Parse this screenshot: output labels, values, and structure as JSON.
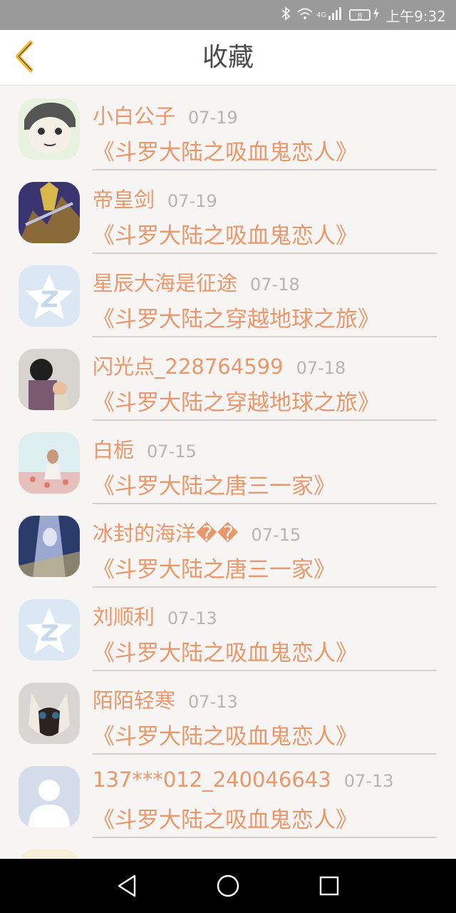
{
  "status_bar": {
    "icons": [
      "bluetooth-icon",
      "wifi-icon",
      "4g-icon",
      "signal-icon"
    ],
    "network": "4G",
    "battery": "8",
    "time": "上午9:32"
  },
  "header": {
    "title": "收藏",
    "back_icon": "chevron-left-icon"
  },
  "items": [
    {
      "user": "小白公子",
      "date": "07-19",
      "book": "《斗罗大陆之吸血鬼恋人》"
    },
    {
      "user": "帝皇剑",
      "date": "07-19",
      "book": "《斗罗大陆之吸血鬼恋人》"
    },
    {
      "user": "星辰大海是征途",
      "date": "07-18",
      "book": "《斗罗大陆之穿越地球之旅》"
    },
    {
      "user": "闪光点_228764599",
      "date": "07-18",
      "book": "《斗罗大陆之穿越地球之旅》"
    },
    {
      "user": "白栀",
      "date": "07-15",
      "book": "《斗罗大陆之唐三一家》"
    },
    {
      "user": "冰封的海洋��",
      "date": "07-15",
      "book": "《斗罗大陆之唐三一家》"
    },
    {
      "user": "刘顺利",
      "date": "07-13",
      "book": "《斗罗大陆之吸血鬼恋人》"
    },
    {
      "user": "陌陌轻寒",
      "date": "07-13",
      "book": "《斗罗大陆之吸血鬼恋人》"
    },
    {
      "user": "137***012_240046643",
      "date": "07-13",
      "book": "《斗罗大陆之吸血鬼恋人》"
    }
  ],
  "nav_bar": {
    "icons": [
      "back-triangle-icon",
      "home-circle-icon",
      "recents-square-icon"
    ]
  },
  "colors": {
    "accent": "#e8986a",
    "date": "#b9b3b3",
    "status_bar": "#9a9a9a",
    "back_arrow": "#f2b92a"
  }
}
